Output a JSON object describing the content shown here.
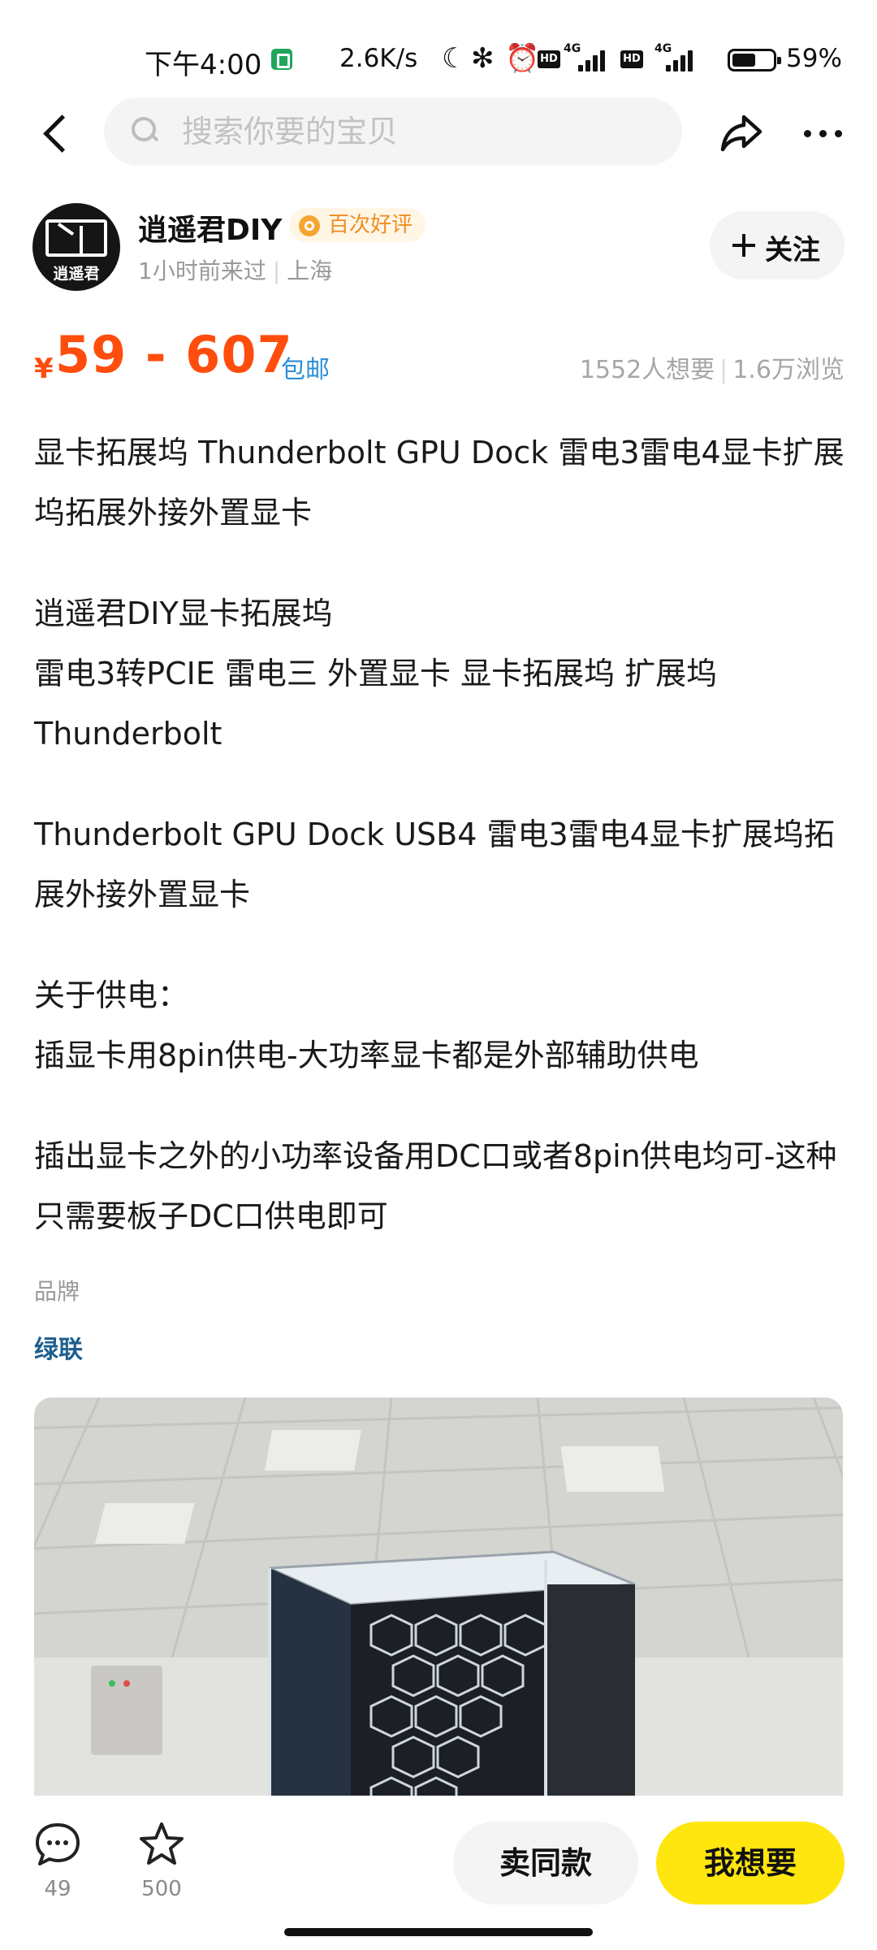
{
  "status_bar": {
    "time": "下午4:00",
    "network_speed": "2.6K/s",
    "hd_label": "HD",
    "net_type": "4G",
    "battery_level": 0.59,
    "battery_text": "59%"
  },
  "search": {
    "placeholder": "搜索你要的宝贝"
  },
  "seller": {
    "name": "逍遥君DIY",
    "avatar_text": "逍遥君",
    "badge": "百次好评",
    "last_visit": "1小时前来过",
    "location": "上海",
    "follow_label": "关注"
  },
  "product": {
    "currency": "¥",
    "price_range": "59 - 607",
    "shipping": "包邮",
    "wants": "1552人想要",
    "views": "1.6万浏览",
    "description": [
      "显卡拓展坞 Thunderbolt GPU Dock 雷电3雷电4显卡扩展坞拓展外接外置显卡",
      "逍遥君DIY显卡拓展坞\n雷电3转PCIE 雷电三 外置显卡 显卡拓展坞 扩展坞\nThunderbolt",
      "Thunderbolt GPU Dock USB4 雷电3雷电4显卡扩展坞拓展外接外置显卡",
      "关于供电：\n插显卡用8pin供电-大功率显卡都是外部辅助供电",
      "插出显卡之外的小功率设备用DC口或者8pin供电均可-这种只需要板子DC口供电即可"
    ],
    "brand_label": "品牌",
    "brand_value": "绿联"
  },
  "bottom_bar": {
    "comments_count": "49",
    "favorites_count": "500",
    "same_label": "卖同款",
    "want_label": "我想要"
  },
  "colors": {
    "price": "#ff4d0d",
    "link": "#2b8fd9",
    "brand": "#1e5f8f",
    "want_button": "#ffe60f",
    "badge_text": "#ef8d22"
  }
}
